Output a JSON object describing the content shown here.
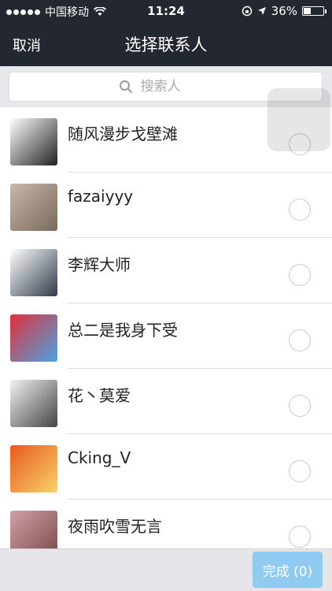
{
  "status_bar": {
    "carrier": "中国移动",
    "time": "11:24",
    "battery": "36%",
    "battery_level": 0.36
  },
  "nav": {
    "cancel": "取消",
    "title": "选择联系人"
  },
  "search": {
    "placeholder": "搜索人"
  },
  "contacts": [
    {
      "name": "随风漫步戈壁滩",
      "avatar_colors": [
        "#ffffff",
        "#222222"
      ]
    },
    {
      "name": "fazaiyyy",
      "avatar_colors": [
        "#c9b8a8",
        "#7a6a5c"
      ]
    },
    {
      "name": "李辉大师",
      "avatar_colors": [
        "#ffffff",
        "#2f3b4a"
      ]
    },
    {
      "name": "总二是我身下受",
      "avatar_colors": [
        "#e0303a",
        "#4ca3e0"
      ]
    },
    {
      "name": "花丶莫爱",
      "avatar_colors": [
        "#f2f2f2",
        "#444444"
      ]
    },
    {
      "name": "Cking_V",
      "avatar_colors": [
        "#e85a1e",
        "#f8d26a"
      ]
    },
    {
      "name": "夜雨吹雪无言",
      "avatar_colors": [
        "#d0a0a8",
        "#7a4a4a"
      ]
    }
  ],
  "bottom": {
    "done": "完成 (0)"
  },
  "colors": {
    "nav_background": "#23272f",
    "done_button": "#8fcaf0"
  }
}
